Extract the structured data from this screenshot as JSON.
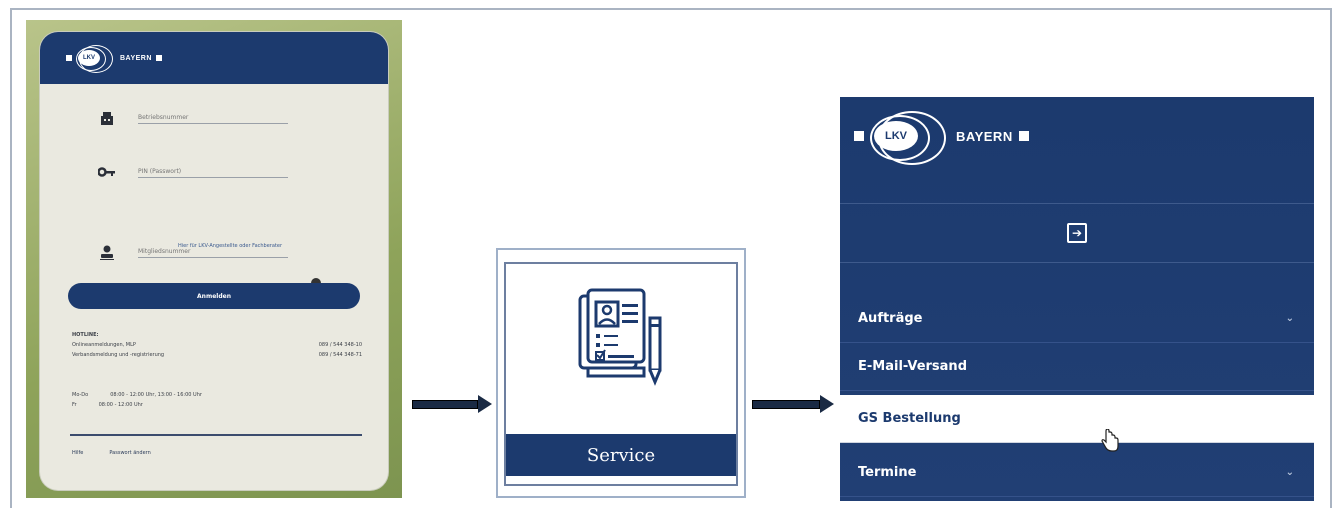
{
  "login_panel": {
    "logo_text": "BAYERN",
    "logo_core": "LKV",
    "fields": [
      {
        "name": "betriebsnummer",
        "placeholder": "Betriebsnummer",
        "icon": "building-icon"
      },
      {
        "name": "pin",
        "placeholder": "PIN (Passwort)",
        "icon": "key-icon"
      },
      {
        "name": "mitgliedsnummer",
        "placeholder": "Mitgliedsnummer",
        "icon": "person-icon"
      }
    ],
    "help_link": "Hier für LKV-Angestellte oder Fachberater",
    "login_button": "Anmelden",
    "hotline": {
      "title": "HOTLINE:",
      "rows": [
        {
          "label": "Onlineanmeldungen, MLP",
          "phone": "089 / 544 348-10"
        },
        {
          "label": "Verbandsmeldung und -registrierung",
          "phone": "089 / 544 348-71"
        }
      ]
    },
    "hours": [
      {
        "days": "Mo-Do",
        "time": "08:00 - 12:00 Uhr, 13:00 - 16:00 Uhr"
      },
      {
        "days": "Fr",
        "time": "08:00 - 12:00 Uhr"
      }
    ],
    "footer_links": [
      "Hilfe",
      "Passwort ändern"
    ]
  },
  "service_panel": {
    "label": "Service",
    "icon": "document-form-icon"
  },
  "menu_panel": {
    "logo_text": "BAYERN",
    "logo_core": "LKV",
    "login_icon": "sign-in-icon",
    "items": [
      {
        "label": "Aufträge",
        "has_chevron": true,
        "active": false
      },
      {
        "label": "E-Mail-Versand",
        "has_chevron": false,
        "active": false
      },
      {
        "label": "GS Bestellung",
        "has_chevron": false,
        "active": true
      },
      {
        "label": "Termine",
        "has_chevron": true,
        "active": false
      }
    ],
    "chevron_glyph": "⌄"
  },
  "colors": {
    "brand_navy": "#1c3a6e",
    "white": "#ffffff",
    "login_bg": "#eae9e0"
  }
}
